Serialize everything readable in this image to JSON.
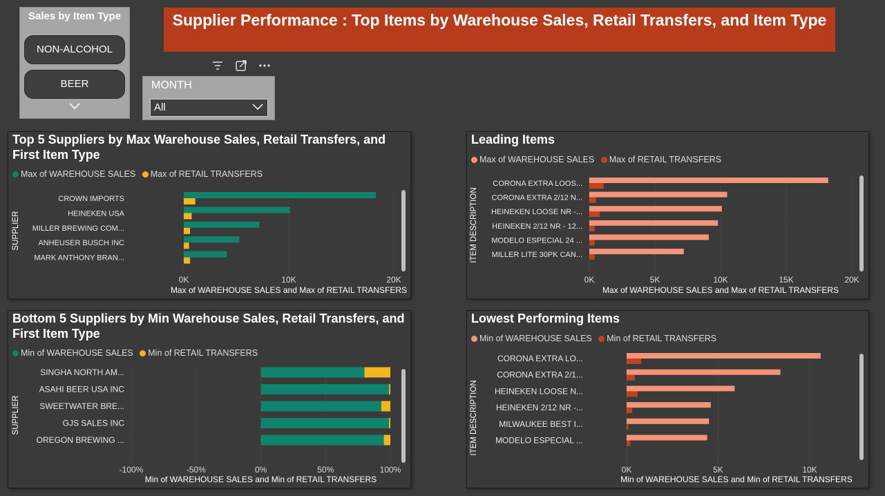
{
  "header": {
    "title": "Supplier Performance : Top Items by Warehouse Sales, Retail Transfers, and Item Type"
  },
  "item_type_slicer": {
    "title": "Sales by Item Type",
    "options": [
      "NON-ALCOHOL",
      "BEER"
    ]
  },
  "month_slicer": {
    "label": "MONTH",
    "selected": "All"
  },
  "toolbar": {
    "icons": [
      "filter-icon",
      "focus-mode-icon",
      "more-options-icon"
    ]
  },
  "colors": {
    "background": "#3b3b3b",
    "title_bar": "#b73c1c",
    "teal": "#10836c",
    "gold": "#f2b61e",
    "salmon": "#f4947a",
    "rust": "#c0441f"
  },
  "chart_data": [
    {
      "id": "top5",
      "type": "bar",
      "orientation": "horizontal",
      "title": "Top 5 Suppliers by Max Warehouse Sales, Retail Transfers, and First Item Type",
      "ylabel": "SUPPLIER",
      "xlabel": "Max of WAREHOUSE SALES and Max of RETAIL TRANSFERS",
      "categories": [
        "CROWN IMPORTS",
        "HEINEKEN USA",
        "MILLER BREWING COM...",
        "ANHEUSER BUSCH INC",
        "MARK ANTHONY BRAN..."
      ],
      "series": [
        {
          "name": "Max of WAREHOUSE SALES",
          "color": "#10836c",
          "values": [
            18300,
            10100,
            7200,
            5300,
            4100
          ]
        },
        {
          "name": "Max of RETAIL TRANSFERS",
          "color": "#f2b61e",
          "values": [
            1100,
            750,
            600,
            500,
            600
          ]
        }
      ],
      "xlim": [
        0,
        20000
      ],
      "ticks": [
        0,
        10000,
        20000
      ],
      "tick_labels": [
        "0K",
        "10K",
        "20K"
      ],
      "legend_position": "top-left"
    },
    {
      "id": "leading",
      "type": "bar",
      "orientation": "horizontal",
      "title": "Leading Items",
      "ylabel": "ITEM DESCRIPTION",
      "xlabel": "Max of WAREHOUSE SALES and Max of RETAIL TRANSFERS",
      "categories": [
        "CORONA EXTRA LOOS...",
        "CORONA EXTRA 2/12 N...",
        "HEINEKEN LOOSE NR -...",
        "HEINEKEN 2/12 NR - 12...",
        "MODELO ESPECIAL 24 ...",
        "MILLER LITE 30PK CAN..."
      ],
      "series": [
        {
          "name": "Max of WAREHOUSE SALES",
          "color": "#f4947a",
          "values": [
            18200,
            10500,
            10100,
            9800,
            9100,
            7200
          ]
        },
        {
          "name": "Max of RETAIL TRANSFERS",
          "color": "#c0441f",
          "values": [
            1100,
            500,
            800,
            400,
            400,
            400
          ]
        }
      ],
      "xlim": [
        0,
        20000
      ],
      "ticks": [
        0,
        5000,
        10000,
        15000,
        20000
      ],
      "tick_labels": [
        "0K",
        "5K",
        "10K",
        "15K",
        "20K"
      ],
      "legend_position": "top-left"
    },
    {
      "id": "bottom5",
      "type": "bar",
      "orientation": "horizontal",
      "stacked": "percent",
      "title": "Bottom 5 Suppliers by Min Warehouse Sales, Retail Transfers, and First Item Type",
      "ylabel": "SUPPLIER",
      "xlabel": "Min of WAREHOUSE SALES and Min of RETAIL TRANSFERS",
      "categories": [
        "SINGHA NORTH AM...",
        "ASAHI BEER USA INC",
        "SWEETWATER BRE...",
        "GJS SALES INC",
        "OREGON BREWING ..."
      ],
      "series": [
        {
          "name": "Min of WAREHOUSE SALES",
          "color": "#10836c",
          "values": [
            80,
            99,
            93,
            99,
            95
          ]
        },
        {
          "name": "Min of RETAIL TRANSFERS",
          "color": "#f2b61e",
          "values": [
            20,
            1,
            7,
            1,
            5
          ]
        }
      ],
      "xlim": [
        -100,
        100
      ],
      "ticks": [
        -100,
        -50,
        0,
        50,
        100
      ],
      "tick_labels": [
        "-100%",
        "-50%",
        "0%",
        "50%",
        "100%"
      ],
      "legend_position": "top-left"
    },
    {
      "id": "lowest",
      "type": "bar",
      "orientation": "horizontal",
      "title": "Lowest Performing Items",
      "ylabel": "ITEM DESCRIPTION",
      "xlabel": "Min of WAREHOUSE SALES and Min of RETAIL TRANSFERS",
      "categories": [
        "CORONA EXTRA LO...",
        "CORONA EXTRA 2/1...",
        "HEINEKEN LOOSE N...",
        "HEINEKEN 2/12 NR -...",
        "MILWAUKEE BEST I...",
        "MODELO ESPECIAL ..."
      ],
      "series": [
        {
          "name": "Min of WAREHOUSE SALES",
          "color": "#f4947a",
          "values": [
            10600,
            8400,
            5900,
            4600,
            4500,
            4400
          ]
        },
        {
          "name": "Min of RETAIL TRANSFERS",
          "color": "#c0441f",
          "values": [
            800,
            450,
            600,
            300,
            100,
            200
          ]
        }
      ],
      "xlim": [
        0,
        12000
      ],
      "ticks": [
        0,
        5000,
        10000
      ],
      "tick_labels": [
        "0K",
        "5K",
        "10K"
      ],
      "legend_position": "top-left"
    }
  ]
}
